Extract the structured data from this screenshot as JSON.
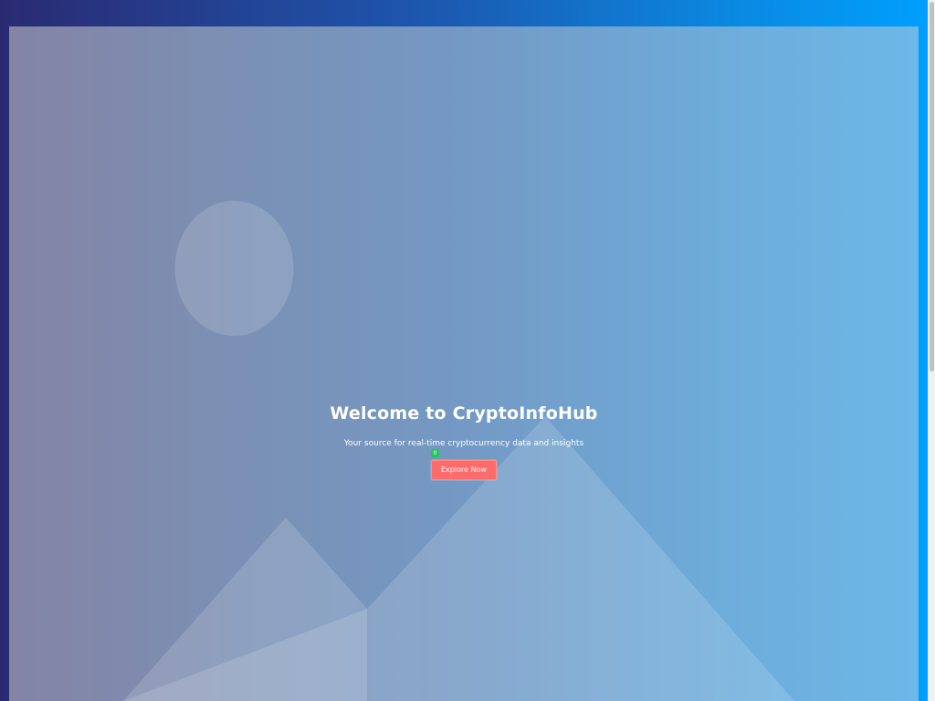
{
  "hero": {
    "title": "Welcome to CryptoInfoHub",
    "subtitle": "Your source for real-time cryptocurrency data and insights",
    "cta_label": "Explore Now",
    "badge_count": "0",
    "image_icon": "image-placeholder-icon"
  },
  "colors": {
    "page_gradient_start": "#2a2a72",
    "page_gradient_end": "#009ffd",
    "cta_background": "#ff6b6b",
    "badge_background": "#22c55e"
  }
}
